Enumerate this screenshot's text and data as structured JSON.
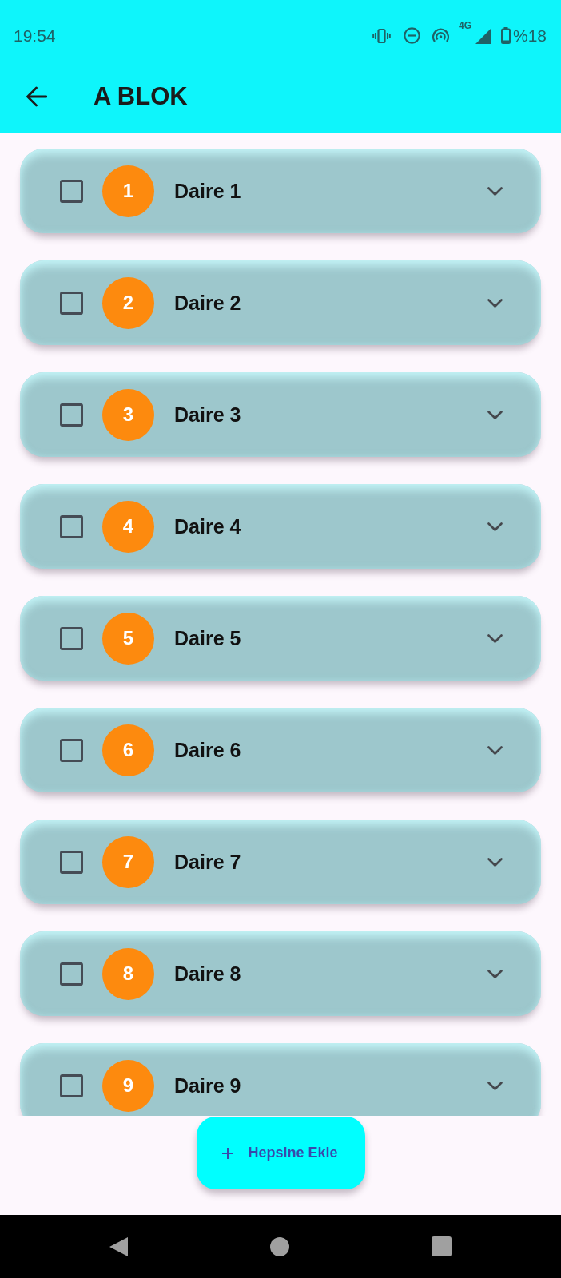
{
  "status_bar": {
    "time": "19:54",
    "network": "4G",
    "battery": "%18"
  },
  "app_bar": {
    "title": "A BLOK"
  },
  "apartments": [
    {
      "number": "1",
      "name": "Daire 1",
      "checked": false,
      "expanded": false
    },
    {
      "number": "2",
      "name": "Daire 2",
      "checked": false,
      "expanded": false
    },
    {
      "number": "3",
      "name": "Daire 3",
      "checked": false,
      "expanded": false
    },
    {
      "number": "4",
      "name": "Daire 4",
      "checked": false,
      "expanded": false
    },
    {
      "number": "5",
      "name": "Daire 5",
      "checked": false,
      "expanded": false
    },
    {
      "number": "6",
      "name": "Daire 6",
      "checked": false,
      "expanded": false
    },
    {
      "number": "7",
      "name": "Daire 7",
      "checked": false,
      "expanded": false
    },
    {
      "number": "8",
      "name": "Daire 8",
      "checked": false,
      "expanded": false
    },
    {
      "number": "9",
      "name": "Daire 9",
      "checked": false,
      "expanded": false
    }
  ],
  "add_all_button": {
    "label": "Hepsine Ekle"
  }
}
